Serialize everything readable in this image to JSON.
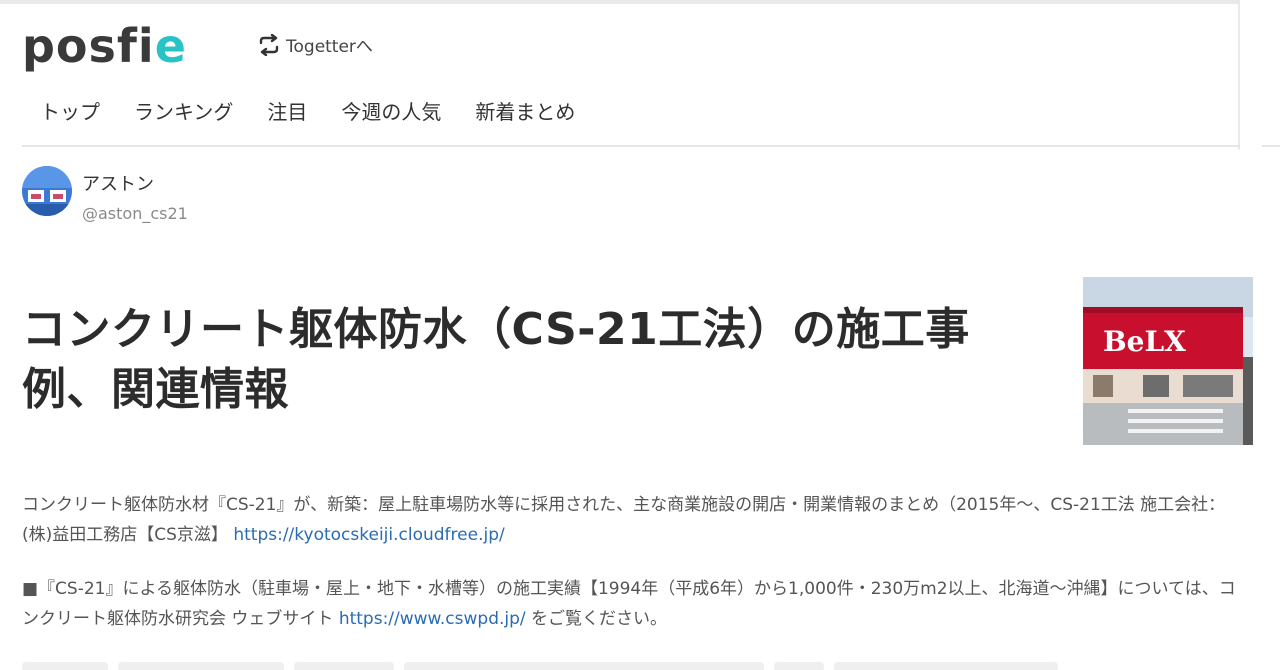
{
  "header": {
    "logo": {
      "part1": "posfi",
      "part2": "e"
    },
    "together_link": "Togetterへ",
    "nav": [
      "トップ",
      "ランキング",
      "注目",
      "今週の人気",
      "新着まとめ"
    ]
  },
  "author": {
    "name": "アストン",
    "handle": "@aston_cs21"
  },
  "article": {
    "title_line1": "コンクリート躯体防水（CS-21工法）の施工事",
    "title_line2": "例、関連情報",
    "thumb_sign": "BeLX",
    "desc1_text": "コンクリート躯体防水材『CS-21』が、新築：屋上駐車場防水等に採用された、主な商業施設の開店・開業情報のまとめ（2015年〜、CS-21工法 施工会社：(株)益田工務店【CS京滋】 ",
    "desc1_link": "https://kyotocskeiji.cloudfree.jp/",
    "desc2_text": "■『CS-21』による躯体防水（駐車場・屋上・地下・水槽等）の施工実績【1994年（平成6年）から1,000件・230万m2以上、北海道〜沖縄】については、コンクリート躯体防水研究会 ウェブサイト ",
    "desc2_link": "https://www.cswpd.jp/",
    "desc2_tail": " をご覧ください。"
  }
}
